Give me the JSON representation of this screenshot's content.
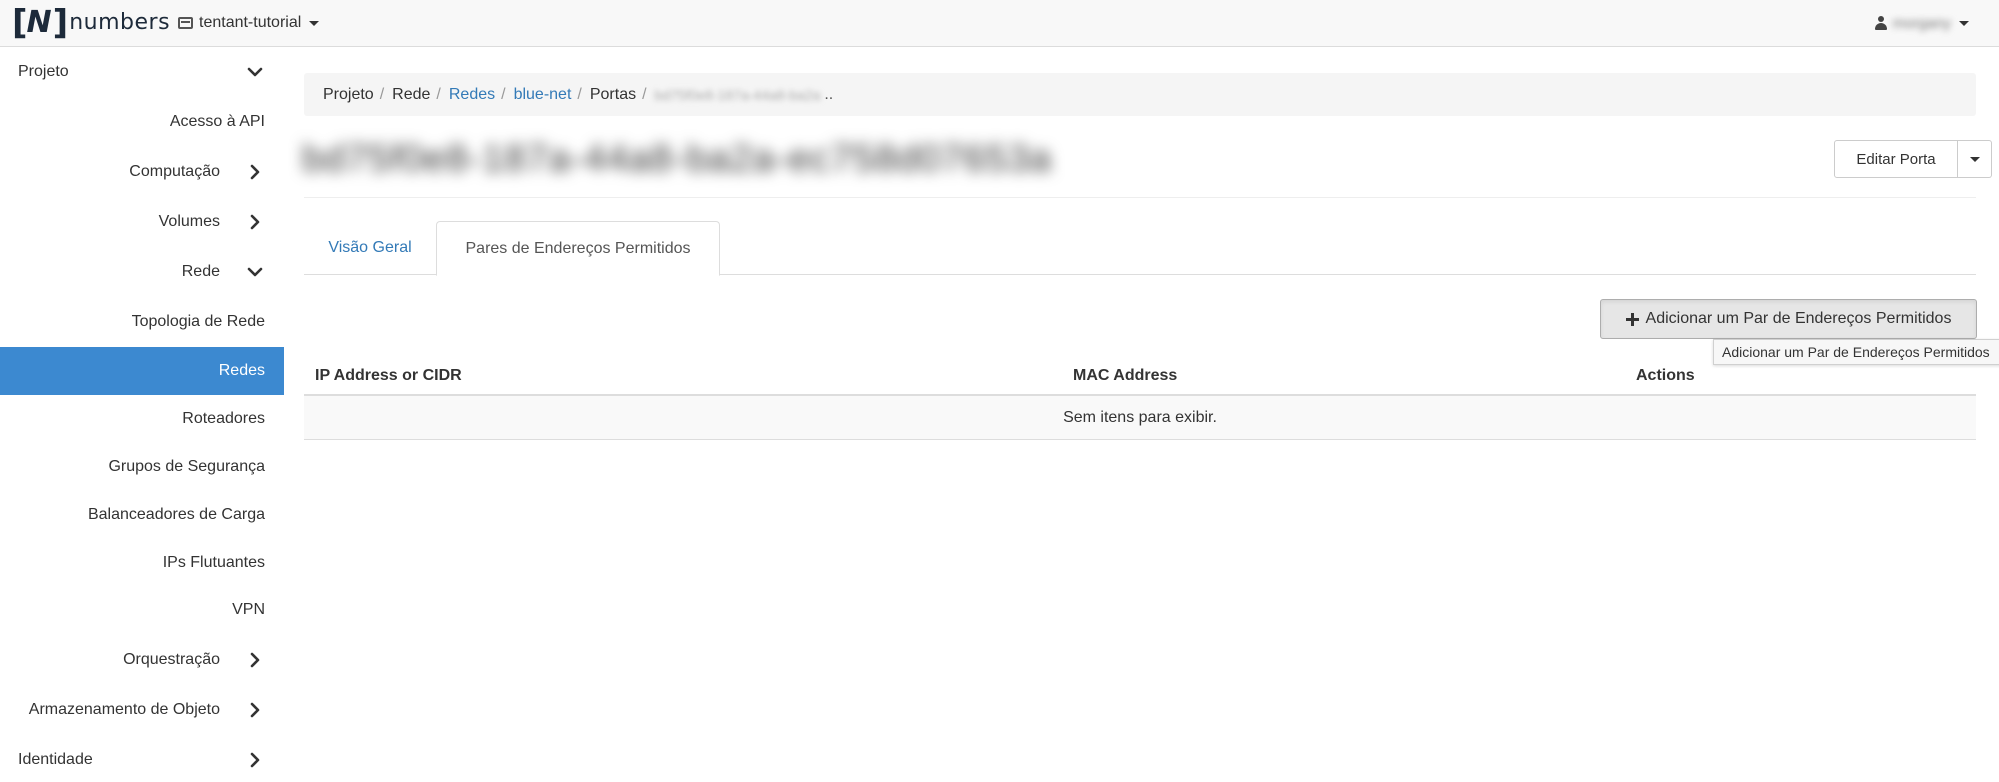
{
  "brand": {
    "bracket_open": "[",
    "letter": "N",
    "bracket_close": "]",
    "word": "numbers"
  },
  "header": {
    "project_name": "tentant-tutorial",
    "user_name": "morgany"
  },
  "sidebar": {
    "items": [
      {
        "label": "Projeto",
        "level": "top",
        "chevron": "down"
      },
      {
        "label": "Acesso à API",
        "level": "leaf"
      },
      {
        "label": "Computação",
        "level": "group",
        "chevron": "right"
      },
      {
        "label": "Volumes",
        "level": "group",
        "chevron": "right"
      },
      {
        "label": "Rede",
        "level": "group",
        "chevron": "down"
      },
      {
        "label": "Topologia de Rede",
        "level": "leaf"
      },
      {
        "label": "Redes",
        "level": "leaf",
        "active": true
      },
      {
        "label": "Roteadores",
        "level": "leaf"
      },
      {
        "label": "Grupos de Segurança",
        "level": "leaf"
      },
      {
        "label": "Balanceadores de Carga",
        "level": "leaf"
      },
      {
        "label": "IPs Flutuantes",
        "level": "leaf"
      },
      {
        "label": "VPN",
        "level": "leaf"
      },
      {
        "label": "Orquestração",
        "level": "group",
        "chevron": "right"
      },
      {
        "label": "Armazenamento de Objeto",
        "level": "group",
        "chevron": "right"
      },
      {
        "label": "Identidade",
        "level": "top",
        "chevron": "right"
      }
    ]
  },
  "breadcrumb": {
    "items": [
      "Projeto",
      "Rede",
      "Redes",
      "blue-net",
      "Portas"
    ],
    "current": "bd75f0e8-187a-44a8-ba2a",
    "ellipsis": ".."
  },
  "page": {
    "title": "bd75f0e8-187a-44a8-ba2a-ec758d07653a",
    "edit_button": "Editar Porta"
  },
  "tabs": {
    "overview": "Visão Geral",
    "pairs": "Pares de Endereços Permitidos"
  },
  "actions": {
    "add_button": "Adicionar um Par de Endereços Permitidos",
    "add_tooltip": "Adicionar um Par de Endereços Permitidos"
  },
  "table": {
    "columns": [
      "IP Address or CIDR",
      "MAC Address",
      "Actions"
    ],
    "empty_text": "Sem itens para exibir."
  },
  "colors": {
    "active_nav": "#3c89d0",
    "link": "#337ab7",
    "navbar_bg": "#f8f8f8"
  }
}
